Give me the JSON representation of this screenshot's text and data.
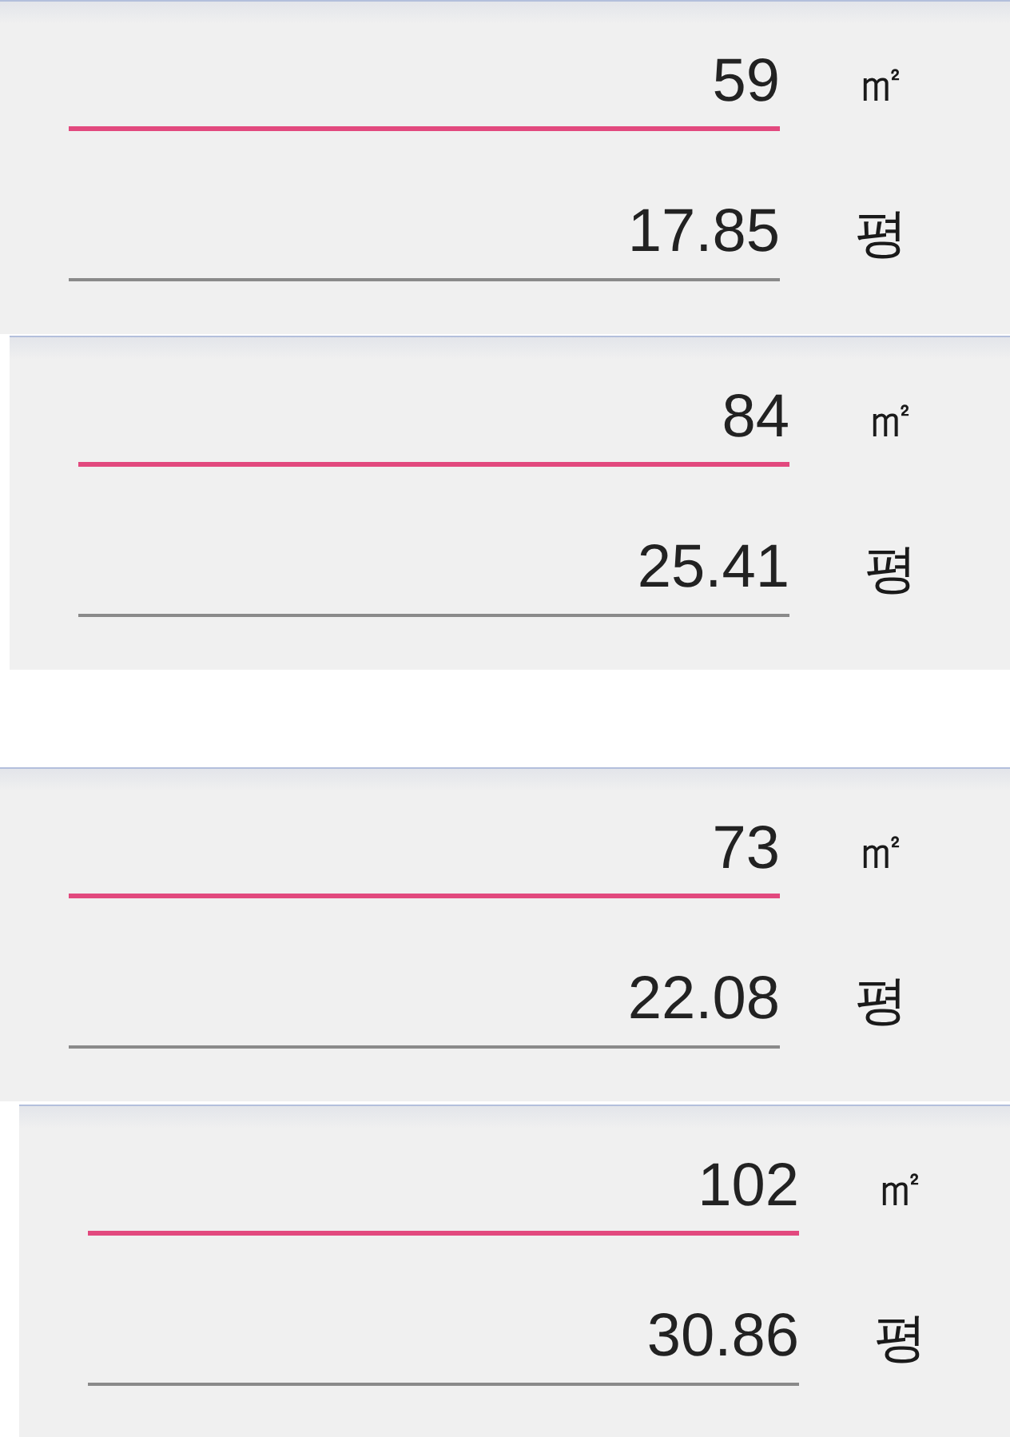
{
  "panels": [
    {
      "fields": [
        {
          "value": "59",
          "unit": "㎡",
          "focused": true
        },
        {
          "value": "17.85",
          "unit": "평",
          "focused": false
        }
      ]
    },
    {
      "fields": [
        {
          "value": "84",
          "unit": "㎡",
          "focused": true
        },
        {
          "value": "25.41",
          "unit": "평",
          "focused": false
        }
      ]
    },
    {
      "fields": [
        {
          "value": "73",
          "unit": "㎡",
          "focused": true
        },
        {
          "value": "22.08",
          "unit": "평",
          "focused": false
        }
      ]
    },
    {
      "fields": [
        {
          "value": "102",
          "unit": "㎡",
          "focused": true
        },
        {
          "value": "30.86",
          "unit": "평",
          "focused": false
        }
      ]
    }
  ]
}
